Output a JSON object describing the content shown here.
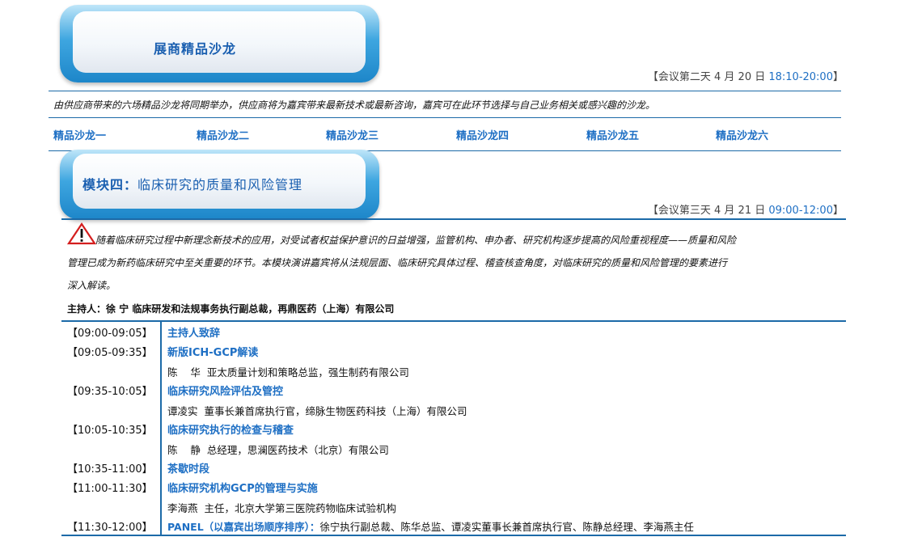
{
  "section1": {
    "title": "展商精品沙龙",
    "time_prefix": "【会议第二天 4 月 20 日 ",
    "time_range": "18:10-20:00",
    "time_suffix": "】",
    "intro": "由供应商带来的六场精品沙龙将同期举办，供应商将为嘉宾带来最新技术或最新咨询，嘉宾可在此环节选择与自己业务相关或感兴趣的沙龙。",
    "salons": [
      "精品沙龙一",
      "精品沙龙二",
      "精品沙龙三",
      "精品沙龙四",
      "精品沙龙五",
      "精品沙龙六"
    ]
  },
  "section2": {
    "title_bold": "模块四：",
    "title_rest": "临床研究的质量和风险管理",
    "time_prefix": "【会议第三天 4 月 21 日 ",
    "time_range": "09:00-12:00",
    "time_suffix": "】",
    "warning_icon": "warning-triangle-icon",
    "para_line1": "随着临床研究过程中新理念新技术的应用，对受试者权益保护意识的日益增强，监管机构、申办者、研究机构逐步提高的风险重视程度——质量和风险",
    "para_line2": "管理已成为新药临床研究中至关重要的环节。本模块演讲嘉宾将从法规层面、临床研究具体过程、稽查核查角度，对临床研究的质量和风险管理的要素进行",
    "para_line3": "深入解读。",
    "host": "主持人：徐  宁  临床研发和法规事务执行副总裁，再鼎医药（上海）有限公司"
  },
  "agenda": [
    {
      "time": "【09:00-09:05】",
      "topic": "主持人致辞",
      "speaker": ""
    },
    {
      "time": "【09:05-09:35】",
      "topic": "新版ICH-GCP解读",
      "speaker": "陈    华  亚太质量计划和策略总监，强生制药有限公司"
    },
    {
      "time": "【09:35-10:05】",
      "topic": "临床研究风险评估及管控",
      "speaker": "谭凌实  董事长兼首席执行官，缔脉生物医药科技（上海）有限公司"
    },
    {
      "time": "【10:05-10:35】",
      "topic": "临床研究执行的检查与稽查",
      "speaker": "陈    静  总经理，思澜医药技术（北京）有限公司"
    },
    {
      "time": "【10:35-11:00】",
      "topic": "茶歇时段",
      "speaker": ""
    },
    {
      "time": "【11:00-11:30】",
      "topic": "临床研究机构GCP的管理与实施",
      "speaker": "李海燕  主任，北京大学第三医院药物临床试验机构"
    },
    {
      "time": "【11:30-12:00】",
      "panel_label": "PANEL（以嘉宾出场顺序排序）：",
      "panel_names": "徐宁执行副总裁、陈华总监、谭凌实董事长兼首席执行官、陈静总经理、李海燕主任"
    }
  ]
}
